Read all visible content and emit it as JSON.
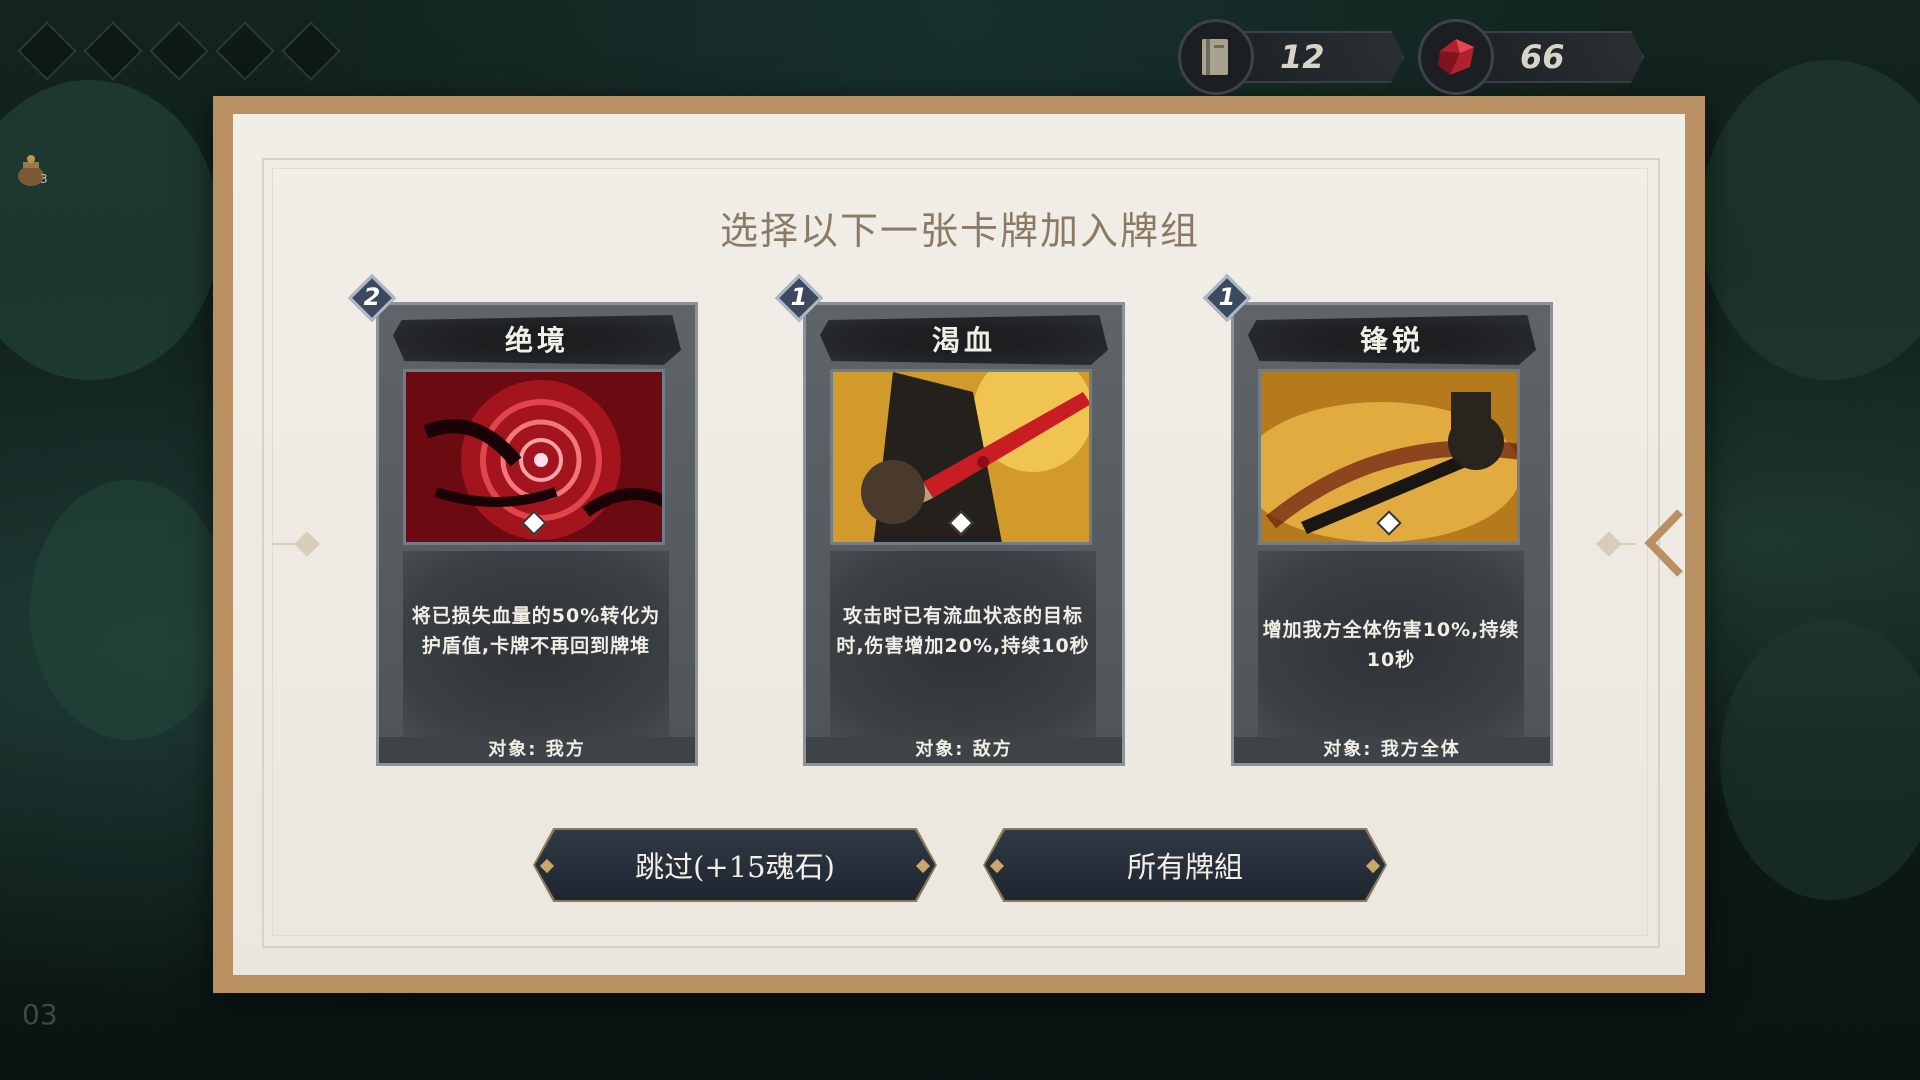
{
  "hud": {
    "deck_count": "12",
    "soul_stones": "66",
    "pot_count": "3",
    "page_number": "03"
  },
  "dialog": {
    "title": "选择以下一张卡牌加入牌组"
  },
  "cards": [
    {
      "cost": "2",
      "name": "绝境",
      "description": "将已损失血量的50%转化为护盾值,卡牌不再回到牌堆",
      "target": "对象: 我方",
      "art": "red-vortex"
    },
    {
      "cost": "1",
      "name": "渴血",
      "description": "攻击时已有流血状态的目标时,伤害增加20%,持续10秒",
      "target": "对象: 敌方",
      "art": "bloody-blade"
    },
    {
      "cost": "1",
      "name": "锋锐",
      "description": "增加我方全体伤害10%,持续10秒",
      "target": "对象: 我方全体",
      "art": "sword-slash"
    }
  ],
  "buttons": {
    "skip": "跳过(+15魂石)",
    "all_decks": "所有牌組"
  },
  "colors": {
    "panel_frame": "#b99061",
    "panel_bg": "#f1eee7",
    "card_bg": "#5e6468",
    "title_text": "#8b7b65",
    "button_bg": "#1e2630"
  }
}
